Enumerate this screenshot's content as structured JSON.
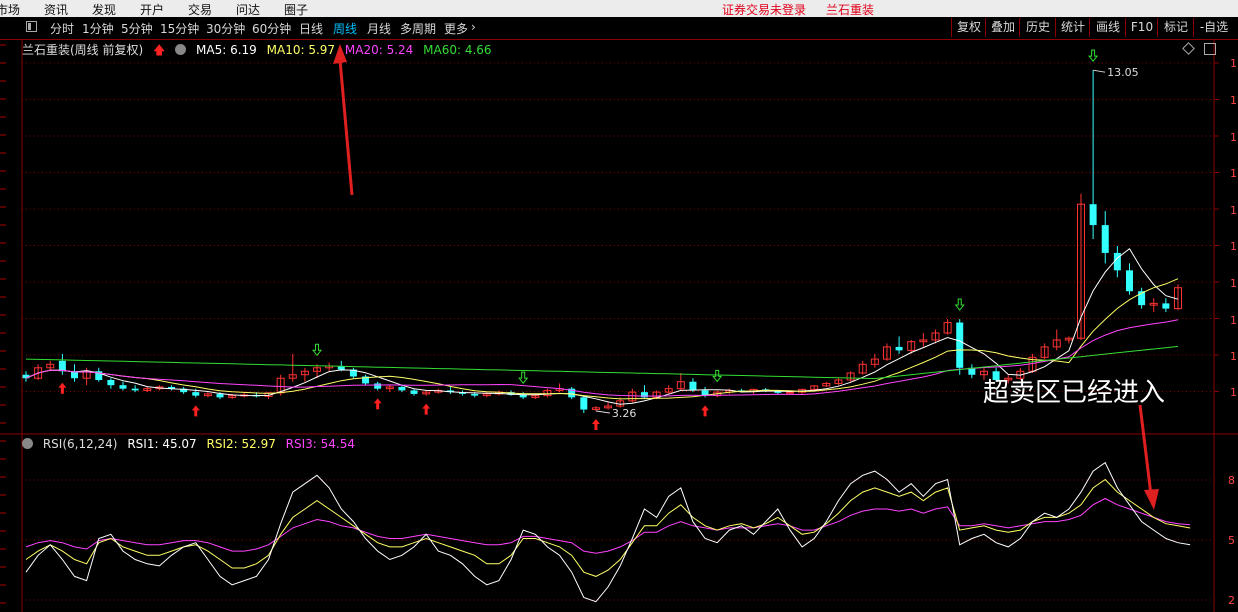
{
  "topmenu": {
    "items": [
      "市场",
      "资讯",
      "发现",
      "开户",
      "交易",
      "问达",
      "圈子"
    ],
    "login_status": "证券交易未登录",
    "stock_name": "兰石重装"
  },
  "toolbar": {
    "periods": [
      "分时",
      "1分钟",
      "5分钟",
      "15分钟",
      "30分钟",
      "60分钟",
      "日线",
      "周线",
      "月线",
      "多周期",
      "更多"
    ],
    "active_period": "周线",
    "right_buttons": [
      "复权",
      "叠加",
      "历史",
      "统计",
      "画线",
      "F10",
      "标记",
      "-自选"
    ]
  },
  "main_panel": {
    "title": "兰石重装(周线 前复权)",
    "ma": [
      {
        "label": "MA5: 6.19",
        "color": "#ffffff"
      },
      {
        "label": "MA10: 5.97",
        "color": "#ffff66"
      },
      {
        "label": "MA20: 5.24",
        "color": "#ff44ff"
      },
      {
        "label": "MA60: 4.66",
        "color": "#33dd33"
      }
    ],
    "high_label": "13.05",
    "low_label": "3.26"
  },
  "rsi_panel": {
    "title": "RSI(6,12,24)",
    "values": [
      {
        "label": "RSI1: 45.07",
        "color": "#ffffff"
      },
      {
        "label": "RSI2: 52.97",
        "color": "#ffff66"
      },
      {
        "label": "RSI3: 54.54",
        "color": "#ff44ff"
      }
    ],
    "axis_labels": [
      "8",
      "5",
      "2"
    ]
  },
  "annotation": "超卖区已经进入",
  "colors": {
    "up": "#ff3333",
    "down": "#33ffff",
    "grid": "#8b0000",
    "ma5": "#ffffff",
    "ma10": "#ffff66",
    "ma20": "#ff44ff",
    "ma60": "#33dd33"
  },
  "chart_data": {
    "type": "candlestick",
    "title": "兰石重装(周线 前复权)",
    "period": "weekly",
    "ohlc": [
      [
        4.3,
        4.4,
        4.1,
        4.2
      ],
      [
        4.2,
        4.6,
        4.15,
        4.5
      ],
      [
        4.5,
        4.7,
        4.4,
        4.6
      ],
      [
        4.7,
        4.9,
        4.3,
        4.4
      ],
      [
        4.4,
        4.6,
        4.1,
        4.2
      ],
      [
        4.2,
        4.5,
        4.0,
        4.4
      ],
      [
        4.4,
        4.5,
        4.1,
        4.15
      ],
      [
        4.15,
        4.2,
        3.9,
        4.0
      ],
      [
        4.0,
        4.1,
        3.85,
        3.9
      ],
      [
        3.9,
        4.0,
        3.8,
        3.85
      ],
      [
        3.85,
        3.95,
        3.8,
        3.9
      ],
      [
        3.9,
        4.0,
        3.85,
        3.95
      ],
      [
        3.95,
        4.0,
        3.85,
        3.9
      ],
      [
        3.9,
        3.95,
        3.75,
        3.8
      ],
      [
        3.8,
        3.9,
        3.65,
        3.7
      ],
      [
        3.7,
        3.8,
        3.65,
        3.75
      ],
      [
        3.75,
        3.8,
        3.6,
        3.65
      ],
      [
        3.65,
        3.75,
        3.6,
        3.7
      ],
      [
        3.7,
        3.8,
        3.65,
        3.72
      ],
      [
        3.72,
        3.8,
        3.65,
        3.68
      ],
      [
        3.68,
        3.8,
        3.6,
        3.78
      ],
      [
        3.78,
        4.3,
        3.7,
        4.2
      ],
      [
        4.2,
        4.9,
        4.1,
        4.3
      ],
      [
        4.3,
        4.5,
        4.1,
        4.4
      ],
      [
        4.4,
        4.6,
        4.2,
        4.5
      ],
      [
        4.5,
        4.65,
        4.4,
        4.55
      ],
      [
        4.55,
        4.7,
        4.4,
        4.45
      ],
      [
        4.45,
        4.5,
        4.2,
        4.25
      ],
      [
        4.25,
        4.3,
        4.0,
        4.05
      ],
      [
        4.05,
        4.1,
        3.85,
        3.9
      ],
      [
        3.9,
        4.0,
        3.8,
        3.95
      ],
      [
        3.95,
        4.0,
        3.8,
        3.85
      ],
      [
        3.85,
        3.9,
        3.7,
        3.75
      ],
      [
        3.75,
        3.85,
        3.7,
        3.8
      ],
      [
        3.8,
        3.9,
        3.75,
        3.85
      ],
      [
        3.85,
        3.95,
        3.75,
        3.8
      ],
      [
        3.8,
        3.85,
        3.7,
        3.75
      ],
      [
        3.75,
        3.8,
        3.65,
        3.7
      ],
      [
        3.7,
        3.8,
        3.65,
        3.75
      ],
      [
        3.75,
        3.85,
        3.7,
        3.8
      ],
      [
        3.8,
        3.85,
        3.7,
        3.72
      ],
      [
        3.72,
        3.8,
        3.6,
        3.65
      ],
      [
        3.65,
        3.75,
        3.6,
        3.7
      ],
      [
        3.7,
        3.9,
        3.65,
        3.85
      ],
      [
        3.85,
        4.05,
        3.8,
        3.9
      ],
      [
        3.9,
        3.95,
        3.6,
        3.65
      ],
      [
        3.65,
        3.7,
        3.2,
        3.3
      ],
      [
        3.3,
        3.4,
        3.26,
        3.35
      ],
      [
        3.35,
        3.5,
        3.3,
        3.4
      ],
      [
        3.4,
        3.65,
        3.35,
        3.55
      ],
      [
        3.55,
        3.9,
        3.5,
        3.8
      ],
      [
        3.8,
        4.0,
        3.6,
        3.65
      ],
      [
        3.65,
        3.85,
        3.6,
        3.8
      ],
      [
        3.8,
        4.0,
        3.75,
        3.9
      ],
      [
        3.9,
        4.35,
        3.85,
        4.1
      ],
      [
        4.1,
        4.2,
        3.8,
        3.85
      ],
      [
        3.85,
        3.95,
        3.65,
        3.7
      ],
      [
        3.7,
        3.85,
        3.65,
        3.8
      ],
      [
        3.8,
        3.9,
        3.75,
        3.85
      ],
      [
        3.85,
        3.9,
        3.8,
        3.82
      ],
      [
        3.82,
        3.9,
        3.75,
        3.88
      ],
      [
        3.88,
        3.92,
        3.8,
        3.82
      ],
      [
        3.82,
        3.85,
        3.75,
        3.78
      ],
      [
        3.78,
        3.85,
        3.72,
        3.8
      ],
      [
        3.8,
        3.9,
        3.75,
        3.88
      ],
      [
        3.88,
        4.0,
        3.85,
        3.98
      ],
      [
        3.98,
        4.1,
        3.95,
        4.05
      ],
      [
        4.05,
        4.2,
        4.0,
        4.15
      ],
      [
        4.15,
        4.4,
        4.1,
        4.35
      ],
      [
        4.35,
        4.7,
        4.3,
        4.6
      ],
      [
        4.6,
        4.9,
        4.5,
        4.75
      ],
      [
        4.75,
        5.2,
        4.7,
        5.1
      ],
      [
        5.1,
        5.4,
        4.9,
        5.0
      ],
      [
        5.0,
        5.3,
        4.9,
        5.25
      ],
      [
        5.25,
        5.5,
        5.1,
        5.3
      ],
      [
        5.3,
        5.6,
        5.2,
        5.5
      ],
      [
        5.5,
        5.9,
        5.45,
        5.8
      ],
      [
        5.8,
        5.9,
        4.3,
        4.5
      ],
      [
        4.5,
        4.6,
        4.2,
        4.3
      ],
      [
        4.3,
        4.5,
        4.15,
        4.4
      ],
      [
        4.4,
        4.5,
        4.1,
        4.15
      ],
      [
        4.15,
        4.3,
        4.05,
        4.2
      ],
      [
        4.2,
        4.5,
        4.15,
        4.4
      ],
      [
        4.4,
        4.9,
        4.35,
        4.8
      ],
      [
        4.8,
        5.2,
        4.75,
        5.1
      ],
      [
        5.1,
        5.6,
        5.0,
        5.3
      ],
      [
        5.3,
        5.4,
        5.2,
        5.35
      ],
      [
        5.35,
        9.5,
        5.3,
        9.2
      ],
      [
        9.2,
        13.05,
        8.2,
        8.6
      ],
      [
        8.6,
        9.0,
        7.5,
        7.8
      ],
      [
        7.8,
        8.0,
        7.1,
        7.3
      ],
      [
        7.3,
        7.5,
        6.6,
        6.7
      ],
      [
        6.7,
        6.8,
        6.2,
        6.3
      ],
      [
        6.3,
        6.5,
        6.1,
        6.35
      ],
      [
        6.35,
        6.5,
        6.1,
        6.2
      ],
      [
        6.2,
        6.9,
        6.15,
        6.8
      ]
    ],
    "ma_values": {
      "MA5": 6.19,
      "MA10": 5.97,
      "MA20": 5.24,
      "MA60": 4.66
    },
    "marked_high": 13.05,
    "marked_low": 3.26,
    "rsi": {
      "RSI1": [
        32,
        40,
        45,
        38,
        30,
        28,
        48,
        50,
        42,
        38,
        36,
        35,
        40,
        44,
        46,
        38,
        30,
        26,
        28,
        30,
        38,
        55,
        70,
        74,
        78,
        72,
        62,
        56,
        48,
        42,
        38,
        40,
        44,
        50,
        42,
        40,
        36,
        30,
        26,
        28,
        38,
        52,
        50,
        44,
        40,
        32,
        20,
        18,
        25,
        35,
        48,
        62,
        58,
        68,
        72,
        56,
        48,
        46,
        52,
        54,
        50,
        56,
        62,
        52,
        44,
        48,
        56,
        66,
        74,
        78,
        80,
        76,
        70,
        74,
        68,
        74,
        76,
        45,
        48,
        50,
        46,
        44,
        48,
        56,
        60,
        58,
        62,
        70,
        80,
        84,
        72,
        64,
        56,
        52,
        48,
        46,
        45.07
      ],
      "RSI2": [
        38,
        42,
        45,
        42,
        38,
        36,
        46,
        48,
        44,
        42,
        40,
        40,
        42,
        44,
        45,
        42,
        38,
        34,
        34,
        36,
        40,
        50,
        58,
        62,
        66,
        62,
        58,
        54,
        50,
        46,
        44,
        44,
        46,
        48,
        46,
        44,
        42,
        40,
        36,
        36,
        40,
        48,
        48,
        46,
        44,
        40,
        32,
        30,
        33,
        38,
        46,
        54,
        54,
        60,
        64,
        58,
        54,
        52,
        54,
        55,
        53,
        55,
        58,
        54,
        50,
        51,
        55,
        60,
        66,
        70,
        72,
        70,
        68,
        70,
        66,
        70,
        72,
        52,
        53,
        54,
        52,
        51,
        52,
        56,
        58,
        58,
        60,
        64,
        72,
        76,
        70,
        66,
        62,
        58,
        55,
        54,
        52.97
      ],
      "RSI3": [
        44,
        46,
        47,
        46,
        44,
        43,
        47,
        48,
        47,
        46,
        45,
        45,
        46,
        47,
        47,
        46,
        44,
        42,
        42,
        43,
        45,
        49,
        53,
        55,
        57,
        56,
        54,
        53,
        51,
        49,
        48,
        48,
        49,
        50,
        49,
        48,
        47,
        46,
        45,
        45,
        46,
        49,
        49,
        48,
        47,
        46,
        42,
        41,
        42,
        44,
        47,
        51,
        51,
        54,
        56,
        54,
        53,
        52,
        53,
        53,
        53,
        54,
        55,
        54,
        52,
        52,
        54,
        56,
        59,
        61,
        62,
        62,
        61,
        62,
        60,
        62,
        63,
        54,
        54,
        55,
        54,
        53,
        54,
        55,
        56,
        56,
        57,
        59,
        64,
        67,
        64,
        62,
        60,
        58,
        56,
        55,
        54.54
      ]
    }
  }
}
